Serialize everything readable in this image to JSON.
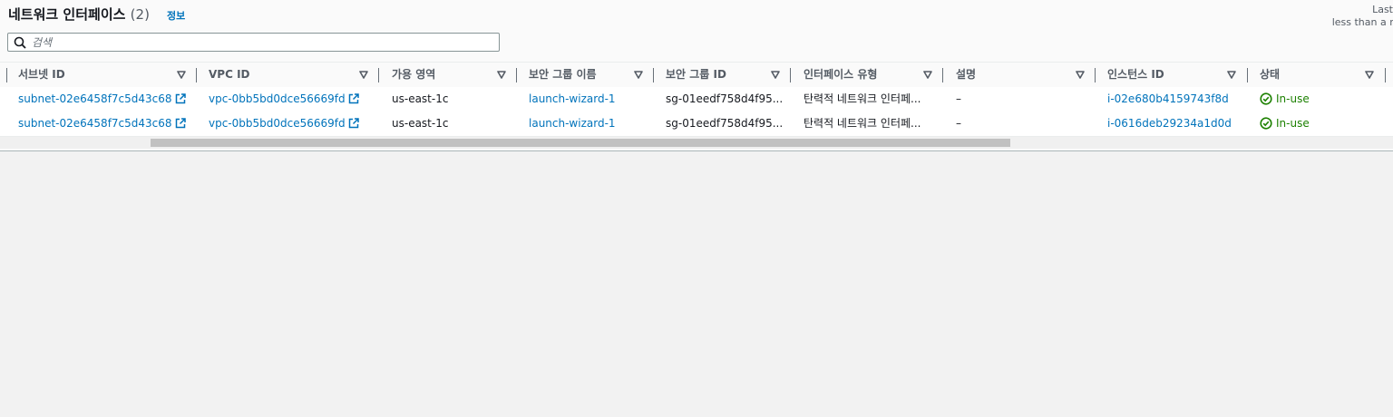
{
  "header": {
    "title": "네트워크 인터페이스",
    "count": "(2)",
    "info_link": "정보",
    "last_updated_line1": "Last",
    "last_updated_line2": "less than a mi"
  },
  "search": {
    "placeholder": "검색",
    "value": ""
  },
  "table": {
    "columns": [
      "서브넷 ID",
      "VPC ID",
      "가용 영역",
      "보안 그룹 이름",
      "보안 그룹 ID",
      "인터페이스 유형",
      "설명",
      "인스턴스 ID",
      "상태"
    ],
    "rows": [
      {
        "subnet_id": "subnet-02e6458f7c5d43c68",
        "vpc_id": "vpc-0bb5bd0dce56669fd",
        "az": "us-east-1c",
        "sg_name": "launch-wizard-1",
        "sg_id": "sg-01eedf758d4f95...",
        "interface_type": "탄력적 네트워크 인터페...",
        "description": "–",
        "instance_id": "i-02e680b4159743f8d",
        "status": "In-use"
      },
      {
        "subnet_id": "subnet-02e6458f7c5d43c68",
        "vpc_id": "vpc-0bb5bd0dce56669fd",
        "az": "us-east-1c",
        "sg_name": "launch-wizard-1",
        "sg_id": "sg-01eedf758d4f95...",
        "interface_type": "탄력적 네트워크 인터페...",
        "description": "–",
        "instance_id": "i-0616deb29234a1d0d",
        "status": "In-use"
      }
    ]
  },
  "icons": {
    "search": "search-icon",
    "sort": "caret-down-icon",
    "external_link": "external-link-icon",
    "status_ok": "check-circle-icon"
  },
  "colors": {
    "link": "#0073bb",
    "success": "#1d8102",
    "text": "#16191f",
    "muted": "#545b64"
  }
}
